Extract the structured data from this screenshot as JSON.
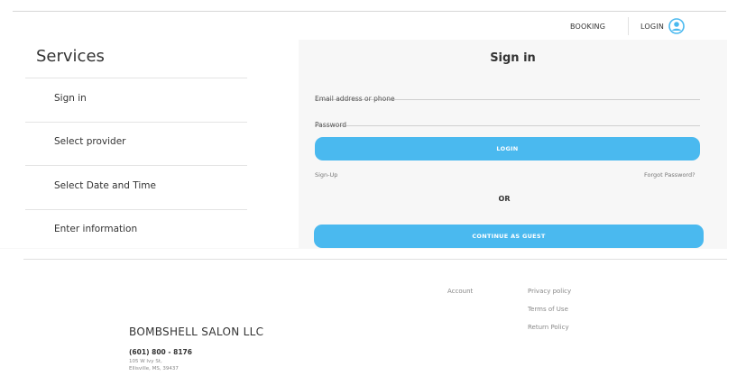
{
  "nav": {
    "booking_label": "BOOKING",
    "login_label": "LOGIN",
    "user_icon": "user-circle-icon"
  },
  "services": {
    "title": "Services",
    "steps": [
      {
        "label": "Sign in"
      },
      {
        "label": "Select provider"
      },
      {
        "label": "Select Date and Time"
      },
      {
        "label": "Enter information"
      }
    ]
  },
  "signin": {
    "title": "Sign in",
    "email_placeholder": "Email address or phone",
    "password_placeholder": "Password",
    "login_button": "LOGIN",
    "signup_link": "Sign-Up",
    "forgot_link": "Forgot Password?",
    "or_label": "OR",
    "guest_button": "CONTINUE AS GUEST"
  },
  "footer": {
    "account_link": "Account",
    "privacy_link": "Privacy policy",
    "terms_link": "Terms of Use",
    "return_link": "Return Policy",
    "company_name": "BOMBSHELL SALON LLC",
    "phone": "(601) 800 - 8176",
    "address_line1": "105 W Ivy St,",
    "address_line2": "Ellisville, MS, 39437"
  },
  "colors": {
    "accent": "#4ab9ef",
    "band": "#f7f7f7"
  }
}
